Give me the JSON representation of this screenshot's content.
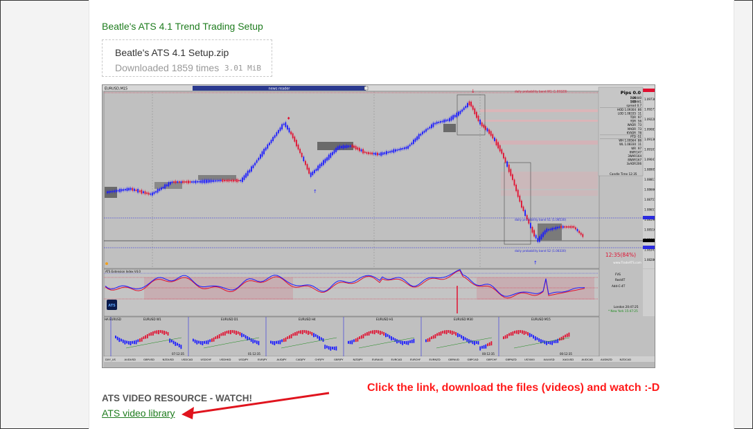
{
  "post": {
    "title": "Beatle's ATS 4.1 Trend Trading Setup"
  },
  "download": {
    "file_name": "Beatle's ATS 4.1 Setup.zip",
    "downloads_text": "Downloaded 1859 times",
    "size": "3.01 MiB"
  },
  "chart_screenshot": {
    "window_title": "EURUSD,M15",
    "news_bar": "news reader",
    "box_title": "Pips 0.0",
    "stats": [
      {
        "label": "ASK",
        "value": "1.09440"
      },
      {
        "label": "BID",
        "value": "1.09441"
      },
      {
        "label": "spread",
        "value": "0.7"
      },
      {
        "label": "HOD 1.09304",
        "value": "86"
      },
      {
        "label": "LOD 1.08335",
        "value": "11"
      },
      {
        "label": "TDR",
        "value": "97"
      },
      {
        "label": "YDR",
        "value": "56"
      },
      {
        "label": "WADR",
        "value": "73"
      },
      {
        "label": "MADR",
        "value": "73"
      },
      {
        "label": "KYADR",
        "value": "78"
      },
      {
        "label": "PTD",
        "value": "-51"
      },
      {
        "label": "WH 1.09564",
        "value": "86"
      },
      {
        "label": "WL 1.08330",
        "value": "11"
      },
      {
        "label": "WR",
        "value": "97"
      },
      {
        "label": "6WR",
        "value": "147"
      },
      {
        "label": "3WAR",
        "value": "164"
      },
      {
        "label": "8WAR",
        "value": "167"
      },
      {
        "label": "3xADR",
        "value": "206"
      }
    ],
    "candle_time": "Candle Time   12:35",
    "band_top": "daily probability band W1 (1.09329)",
    "band_s1": "daily probability band S1 (1.08530)",
    "band_s2": "daily probability band S2 (1.08330)",
    "timer": "12:35(84%)",
    "watermark": "www.TradeATS.com",
    "osc_title": "ATS Extension Index V4.0",
    "osc_labels": [
      "FVS",
      "Rest4T",
      "Add-C-4T"
    ],
    "clock": [
      "London    20:47:25",
      "* New York    15:47:25"
    ],
    "logo": "ATS",
    "mini_panels": [
      "EURUSD W1",
      "EURUSD D1",
      "EURUSD H4",
      "EURUSD H1",
      "EURUSD M30",
      "EURUSD M15"
    ],
    "mini_times": [
      "07:12:35",
      "01:12:35",
      "00:12:35",
      "00:12:35"
    ],
    "symbols": [
      "DXY_US",
      "AUDUSD",
      "GBPUSD",
      "NZDUSD",
      "USDCAD",
      "USDCHF",
      "USDHKD",
      "USDJPY",
      "EURJPY",
      "AUDJPY",
      "CADJPY",
      "CHFJPY",
      "GBPJPY",
      "NZDJPY",
      "EURAUD",
      "EURCAD",
      "EURCHF",
      "EURNZD",
      "GBPAUD",
      "GBPCAD",
      "GBPCHF",
      "GBPNZD",
      "US3000",
      "XAUUSD",
      "XAGUSD",
      "AUDCAD",
      "AUDNZD",
      "NZDCAD"
    ],
    "prices": [
      "1.09736",
      "1.09271",
      "1.09228",
      "1.09081",
      "1.09136",
      "1.09101",
      "1.09041",
      "1.08905",
      "1.08811",
      "1.08666",
      "1.08751",
      "1.08651",
      "1.08596",
      "1.08516",
      "1.08446",
      "1.08341",
      "1.08286"
    ],
    "colors": {
      "bull": "#1a1aff",
      "bear": "#e01030",
      "panel": "#c0c0c0",
      "grid": "#9a9a9a"
    }
  },
  "resources": {
    "heading": "ATS VIDEO RESOURCE - WATCH!",
    "link": "ATS video library"
  },
  "annotation": {
    "text": "Click the link, download the files (videos) and watch :-D",
    "color": "#ff1a1a"
  }
}
